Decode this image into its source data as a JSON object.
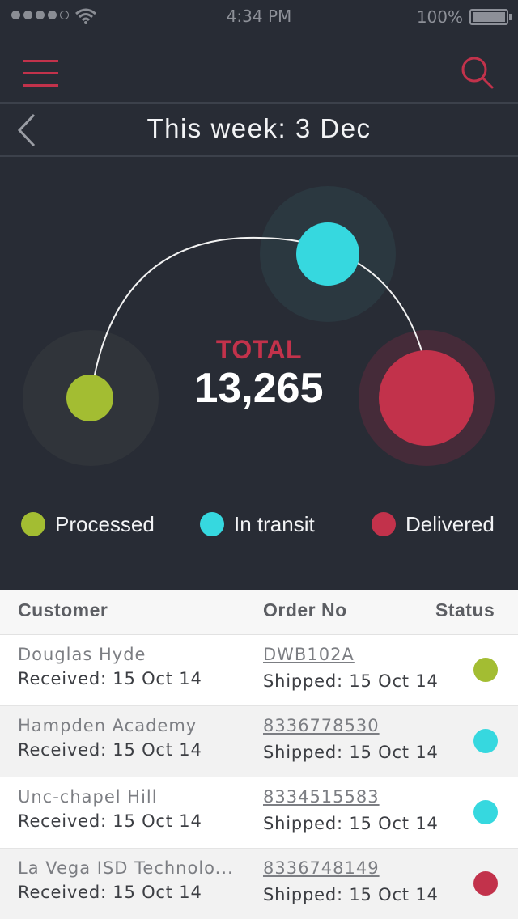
{
  "status_bar": {
    "time": "4:34 PM",
    "battery": "100%",
    "signal_icon": "signal-dots-icon",
    "wifi_icon": "wifi-icon",
    "battery_icon": "battery-icon"
  },
  "nav": {
    "menu_icon": "hamburger-menu-icon",
    "search_icon": "search-icon"
  },
  "week": {
    "back_icon": "chevron-left-icon",
    "title": "This week: 3 Dec"
  },
  "summary": {
    "total_label": "TOTAL",
    "total_value": "13,265"
  },
  "legend": [
    {
      "label": "Processed",
      "color": "#a3bd32"
    },
    {
      "label": "In transit",
      "color": "#36d8df"
    },
    {
      "label": "Delivered",
      "color": "#c2324b"
    }
  ],
  "colors": {
    "accent": "#c2324b",
    "background": "#282c35",
    "processed": "#a3bd32",
    "in_transit": "#36d8df",
    "delivered": "#c2324b"
  },
  "table": {
    "headers": {
      "customer": "Customer",
      "order_no": "Order No",
      "status": "Status"
    },
    "rows": [
      {
        "customer": "Douglas Hyde",
        "received": "Received:   15 Oct 14",
        "order_no": "DWB102A",
        "shipped": "Shipped: 15 Oct 14",
        "status": "Processed",
        "status_color": "#a3bd32"
      },
      {
        "customer": "Hampden Academy",
        "received": "Received:   15 Oct 14",
        "order_no": "8336778530",
        "shipped": "Shipped: 15 Oct 14",
        "status": "In transit",
        "status_color": "#36d8df"
      },
      {
        "customer": "Unc-chapel Hill",
        "received": "Received:   15 Oct 14",
        "order_no": "8334515583",
        "shipped": "Shipped: 15 Oct 14",
        "status": "In transit",
        "status_color": "#36d8df"
      },
      {
        "customer": "La Vega ISD Technolo...",
        "received": "Received: 15 Oct 14",
        "order_no": "8336748149",
        "shipped": "Shipped: 15 Oct 14",
        "status": "Delivered",
        "status_color": "#c2324b"
      }
    ]
  }
}
